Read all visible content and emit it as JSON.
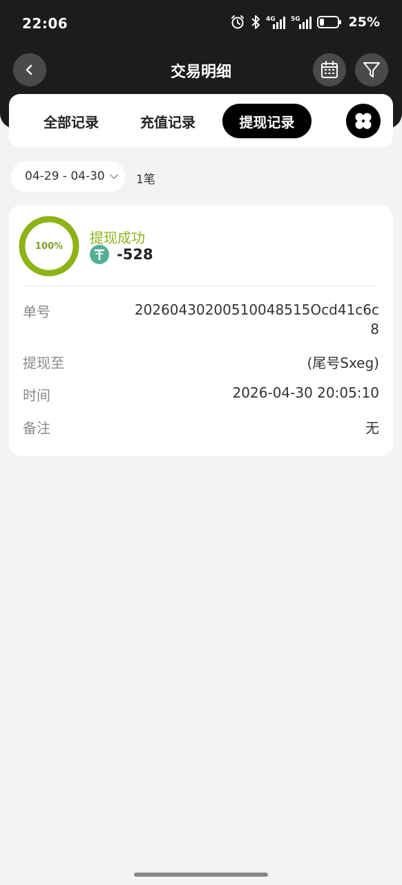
{
  "status_bar": {
    "time": "22:06",
    "signal_4g": "4G",
    "signal_5g": "5G",
    "battery_percent": "25%",
    "battery_level": 0.25
  },
  "nav": {
    "title": "交易明细"
  },
  "tabs": [
    {
      "label": "全部记录",
      "active": false
    },
    {
      "label": "充值记录",
      "active": false
    },
    {
      "label": "提现记录",
      "active": true
    }
  ],
  "filter": {
    "date_range": "04-29 - 04-30",
    "count": "1笔"
  },
  "record": {
    "progress_label": "100%",
    "progress": 1.0,
    "status": "提现成功",
    "amount": "-528",
    "fields": {
      "order_label": "单号",
      "order_value": "20260430200510048515Ocd41c6c8",
      "to_label": "提现至",
      "to_value": "(尾号Sxeg)",
      "time_label": "时间",
      "time_value": "2026-04-30 20:05:10",
      "note_label": "备注",
      "note_value": "无"
    }
  },
  "colors": {
    "header": "#1c1c1c",
    "success": "#8db316",
    "tether": "#53ae94",
    "background": "#f2f3f5"
  }
}
